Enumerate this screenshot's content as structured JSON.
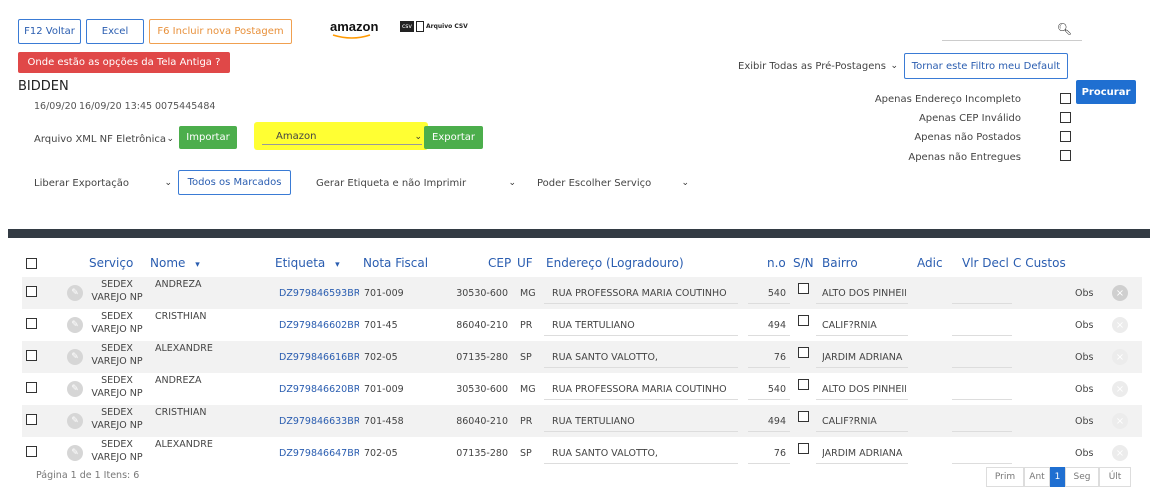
{
  "toolbar": {
    "back_label": "F12 Voltar",
    "excel_label": "Excel",
    "new_label": "F6 Incluir nova Postagem",
    "amazon_logo": "amazon",
    "csv_badge": "csv",
    "csv_label": "Arquivo CSV",
    "old_screen_label": "Onde estão as opções da Tela Antiga ?"
  },
  "filter": {
    "show_select": "Exibir Todas as Pré-Postagens",
    "default_label": "Tornar este Filtro meu Default",
    "search_label": "Procurar",
    "checks": [
      "Apenas Endereço Incompleto",
      "Apenas CEP Inválido",
      "Apenas não Postados",
      "Apenas não Entregues"
    ]
  },
  "account": {
    "name": "BIDDEN",
    "date": "16/09/20",
    "datetime": "16/09/20 13:45",
    "code": "0075445484"
  },
  "actions": {
    "xml_select": "Arquivo XML NF Eletrônica",
    "import_label": "Importar",
    "marketplace_select": "Amazon",
    "export_label": "Exportar",
    "release_select": "Liberar Exportação",
    "all_marked_label": "Todos os Marcados",
    "label_select": "Gerar Etiqueta e não Imprimir",
    "service_select": "Poder Escolher Serviço"
  },
  "table": {
    "headers": {
      "servico": "Serviço",
      "nome": "Nome",
      "etiqueta": "Etiqueta",
      "nota": "Nota Fiscal",
      "cep": "CEP",
      "uf": "UF",
      "endereco": "Endereço (Logradouro)",
      "numero": "n.o",
      "sn": "S/N",
      "bairro": "Bairro",
      "adic": "Adic",
      "vlr": "Vlr Decl",
      "custos": "C Custos"
    },
    "sort_arrow": "▾",
    "rows": [
      {
        "servico1": "SEDEX",
        "servico2": "VAREJO NP",
        "nome": "ANDREZA",
        "etiqueta": "DZ979846593BR",
        "nota": "701-009",
        "cep": "30530-600",
        "uf": "MG",
        "endereco": "RUA PROFESSORA MARIA COUTINHO",
        "numero": "540",
        "bairro": "ALTO DOS PINHEIF",
        "obs": "Obs"
      },
      {
        "servico1": "SEDEX",
        "servico2": "VAREJO NP",
        "nome": "CRISTHIAN",
        "etiqueta": "DZ979846602BR",
        "nota": "701-45",
        "cep": "86040-210",
        "uf": "PR",
        "endereco": "RUA TERTULIANO",
        "numero": "494",
        "bairro": "CALIF?RNIA",
        "obs": "Obs"
      },
      {
        "servico1": "SEDEX",
        "servico2": "VAREJO NP",
        "nome": "ALEXANDRE",
        "etiqueta": "DZ979846616BR",
        "nota": "702-05",
        "cep": "07135-280",
        "uf": "SP",
        "endereco": "RUA SANTO VALOTTO,",
        "numero": "76",
        "bairro": "JARDIM ADRIANA",
        "obs": "Obs"
      },
      {
        "servico1": "SEDEX",
        "servico2": "VAREJO NP",
        "nome": "ANDREZA",
        "etiqueta": "DZ979846620BR",
        "nota": "701-009",
        "cep": "30530-600",
        "uf": "MG",
        "endereco": "RUA PROFESSORA MARIA COUTINHO",
        "numero": "540",
        "bairro": "ALTO DOS PINHEIF",
        "obs": "Obs"
      },
      {
        "servico1": "SEDEX",
        "servico2": "VAREJO NP",
        "nome": "CRISTHIAN",
        "etiqueta": "DZ979846633BR",
        "nota": "701-458",
        "cep": "86040-210",
        "uf": "PR",
        "endereco": "RUA TERTULIANO",
        "numero": "494",
        "bairro": "CALIF?RNIA",
        "obs": "Obs"
      },
      {
        "servico1": "SEDEX",
        "servico2": "VAREJO NP",
        "nome": "ALEXANDRE",
        "etiqueta": "DZ979846647BR",
        "nota": "702-05",
        "cep": "07135-280",
        "uf": "SP",
        "endereco": "RUA SANTO VALOTTO,",
        "numero": "76",
        "bairro": "JARDIM ADRIANA",
        "obs": "Obs"
      }
    ]
  },
  "footer": {
    "page_info": "Página 1 de 1 Itens: 6",
    "pager": {
      "first": "Prim",
      "prev": "Ant",
      "current": "1",
      "next": "Seg",
      "last": "Últ"
    }
  },
  "icons": {
    "search": "search-icon",
    "edit": "pencil-icon",
    "remove": "close-icon",
    "chevron": "chevron-down-icon"
  },
  "colors": {
    "accent": "#1f6fd1",
    "danger": "#e04848",
    "success": "#4cae4c",
    "highlight": "#ffff33",
    "header_bar": "#333b44"
  }
}
